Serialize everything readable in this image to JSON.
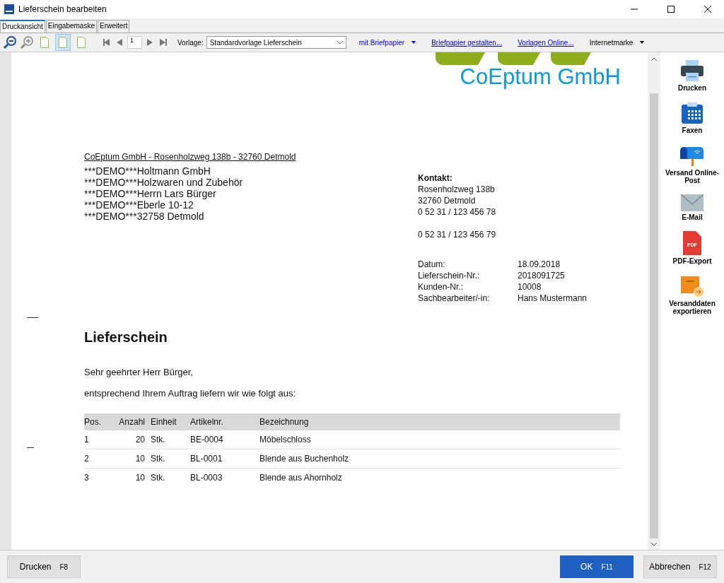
{
  "window": {
    "title": "Lieferschein bearbeiten"
  },
  "tabs": [
    {
      "label": "Druckansicht",
      "selected": true
    },
    {
      "label": "Eingabemaske",
      "selected": false
    },
    {
      "label": "Erweitert",
      "selected": false
    }
  ],
  "toolbar": {
    "page_modes": [
      {
        "selected": false
      },
      {
        "selected": true
      },
      {
        "selected": false
      }
    ],
    "page": "1",
    "template_label": "Vorlage:",
    "template": "Standardvorlage Lieferschein",
    "links": [
      {
        "label": "mit Briefpapier",
        "kind": "dropdown",
        "color": "#0000ee"
      },
      {
        "label": "Briefpapier gestalten...",
        "kind": "link",
        "color": "#0000ee"
      },
      {
        "label": "Vorlagen Online...",
        "kind": "link",
        "color": "#0000ee"
      },
      {
        "label": "Internetmarke",
        "kind": "dropdown",
        "color": "#000000"
      }
    ]
  },
  "document": {
    "company": "CoEptum GmbH",
    "sender_line": "CoEptum GmbH - Rosenholzweg 138b - 32760 Detmold",
    "recipient": [
      "***DEMO***Holtmann GmbH",
      "***DEMO***Holzwaren und Zubehör",
      "***DEMO***Herrn Lars Bürger",
      "***DEMO***Eberle 10-12",
      "***DEMO***32758 Detmold"
    ],
    "contact_title": "Kontakt:",
    "contact": [
      "Rosenholzweg 138b",
      "32760 Detmold",
      "0 52 31 / 123 456 78"
    ],
    "fax": "0 52 31 / 123 456 79",
    "info": [
      {
        "label": "Datum:",
        "value": "18.09.2018"
      },
      {
        "label": "Lieferschein-Nr.:",
        "value": "2018091725"
      },
      {
        "label": "Kunden-Nr.:",
        "value": "10008"
      },
      {
        "label": "Sachbearbeiter/-in:",
        "value": "Hans Mustermann"
      }
    ],
    "heading": "Lieferschein",
    "salutation": "Sehr geehrter Herr Bürger,",
    "intro": "entsprechend Ihrem Auftrag liefern wir wie folgt aus:",
    "table": {
      "columns": [
        "Pos.",
        "Anzahl",
        "Einheit",
        "Artikelnr.",
        "Bezeichnung"
      ],
      "rows": [
        [
          "1",
          "20",
          "Stk.",
          "BE-0004",
          "Möbelschloss"
        ],
        [
          "2",
          "10",
          "Stk.",
          "BL-0001",
          "Blende aus Buchenholz"
        ],
        [
          "3",
          "10",
          "Stk.",
          "BL-0003",
          "Blende aus Ahornholz"
        ]
      ]
    }
  },
  "sidebar": {
    "items": [
      {
        "label": "Drucken",
        "kind": "printer"
      },
      {
        "label": "Faxen",
        "kind": "fax"
      },
      {
        "label": "Versand Online-Post",
        "kind": "mailbox"
      },
      {
        "label": "E-Mail",
        "kind": "mail"
      },
      {
        "label": "PDF-Export",
        "kind": "pdf",
        "badge": "PDF"
      },
      {
        "label": "Versanddaten exportieren",
        "kind": "export"
      }
    ]
  },
  "footer": {
    "buttons": [
      {
        "label": "Drucken",
        "key": "F8",
        "kind": "default"
      },
      {
        "label": "OK",
        "key": "F11",
        "kind": "primary"
      },
      {
        "label": "Abbrechen",
        "key": "F12",
        "kind": "default"
      }
    ]
  }
}
